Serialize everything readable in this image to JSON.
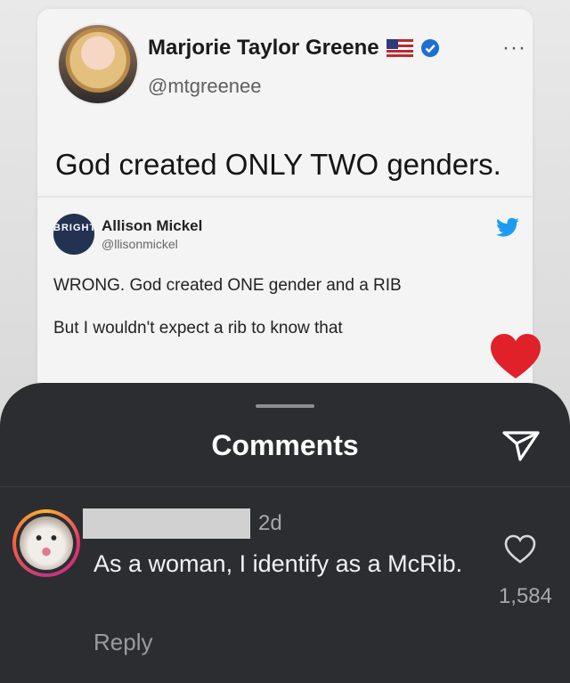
{
  "tweet": {
    "name": "Marjorie Taylor Greene",
    "handle": "@mtgreenee",
    "more_label": "···",
    "text": "God created ONLY TWO genders.",
    "quote": {
      "avatar_text": "BRIGHT",
      "name": "Allison Mickel",
      "handle": "@llisonmickel",
      "line1": "WRONG. God created ONE gender and a RIB",
      "line2": "But I wouldn't expect a rib to know that"
    },
    "icons": [
      "flag-icon",
      "verified-icon",
      "twitter-bird-icon",
      "heart-icon"
    ]
  },
  "comments_sheet": {
    "title": "Comments",
    "share_icon": "send-icon",
    "comment": {
      "time": "2d",
      "text": "As a woman, I identify as a McRib.",
      "likes": "1,584",
      "reply_label": "Reply"
    }
  },
  "colors": {
    "sheet_bg": "#2b2d31",
    "heart_red": "#e0212a",
    "twitter_blue": "#1d9bf0",
    "verified_blue": "#1d6fd1"
  }
}
